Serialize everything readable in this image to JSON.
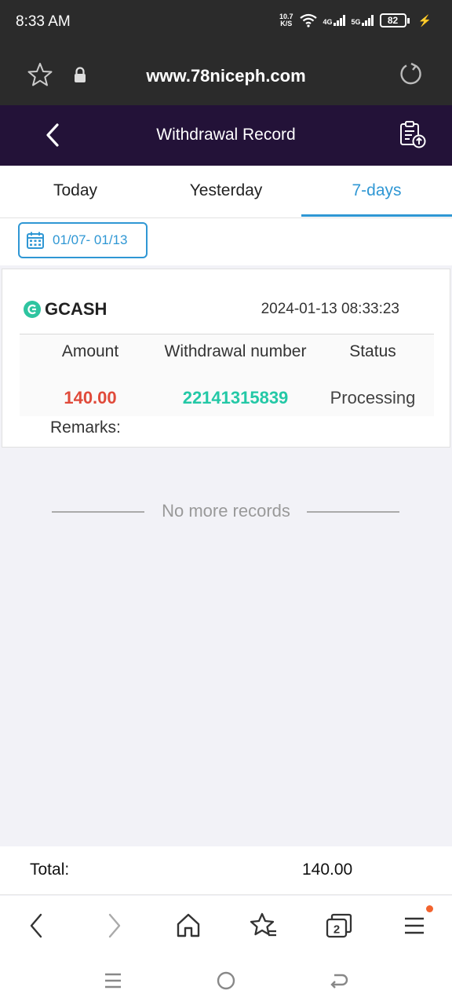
{
  "status_bar": {
    "time": "8:33 AM",
    "net_speed_value": "10.7",
    "net_speed_unit": "K/S",
    "network_1": "4G",
    "network_2": "5G",
    "battery": "82"
  },
  "browser": {
    "url": "www.78niceph.com"
  },
  "header": {
    "title": "Withdrawal Record"
  },
  "tabs": [
    {
      "label": "Today",
      "active": false
    },
    {
      "label": "Yesterday",
      "active": false
    },
    {
      "label": "7-days",
      "active": true
    }
  ],
  "date_filter": {
    "range": "01/07- 01/13"
  },
  "record": {
    "method": "GCASH",
    "datetime": "2024-01-13 08:33:23",
    "headers": {
      "amount": "Amount",
      "number": "Withdrawal number",
      "status": "Status"
    },
    "amount": "140.00",
    "number": "22141315839",
    "status": "Processing",
    "remarks_label": "Remarks:"
  },
  "list_footer": "No more records",
  "total": {
    "label": "Total:",
    "value": "140.00"
  },
  "tab_count": "2",
  "colors": {
    "accent": "#2f97d4",
    "header_bg": "#231238",
    "amount": "#e04a3a",
    "number": "#23c8a6"
  }
}
